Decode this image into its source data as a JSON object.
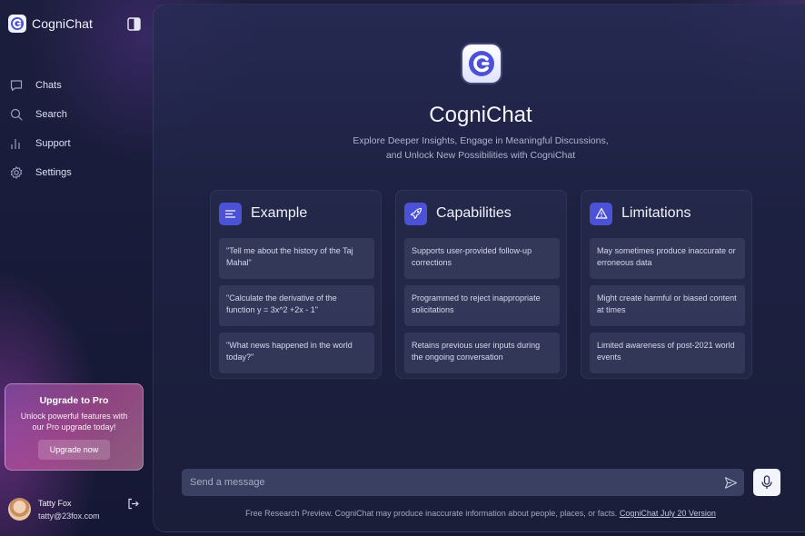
{
  "app": {
    "name": "CogniChat",
    "accent": "#4b52d8"
  },
  "sidebar": {
    "items": [
      {
        "label": "Chats",
        "icon": "chat-bubble-icon"
      },
      {
        "label": "Search",
        "icon": "search-icon"
      },
      {
        "label": "Support",
        "icon": "bar-chart-icon"
      },
      {
        "label": "Settings",
        "icon": "gear-icon"
      }
    ],
    "upgrade": {
      "title": "Upgrade to Pro",
      "text": "Unlock powerful features with our Pro upgrade today!",
      "button": "Upgrade now"
    },
    "user": {
      "name": "Tatty Fox",
      "email": "tatty@23fox.com"
    }
  },
  "main": {
    "title": "CogniChat",
    "subtitle_line1": "Explore Deeper Insights, Engage in Meaningful Discussions,",
    "subtitle_line2": "and Unlock New Possibilities with CogniChat",
    "columns": [
      {
        "title": "Example",
        "icon": "text-lines-icon",
        "cards": [
          "\"Tell me about the history of the Taj Mahal\"",
          "\"Calculate the derivative of the function y = 3x^2 +2x - 1\"",
          "\"What news happened in the world today?\""
        ]
      },
      {
        "title": "Capabilities",
        "icon": "rocket-icon",
        "cards": [
          "Supports user-provided follow-up corrections",
          "Programmed to reject inappropriate solicitations",
          "Retains previous user inputs during the ongoing conversation"
        ]
      },
      {
        "title": "Limitations",
        "icon": "warning-icon",
        "cards": [
          "May sometimes produce inaccurate or erroneous data",
          "Might create harmful or biased content at times",
          "Limited awareness of post-2021 world events"
        ]
      }
    ],
    "composer": {
      "placeholder": "Send a message"
    },
    "footer": {
      "text": "Free Research Preview. CogniChat may produce inaccurate information about people, places, or facts.",
      "link": "CogniChat July 20 Version"
    }
  }
}
